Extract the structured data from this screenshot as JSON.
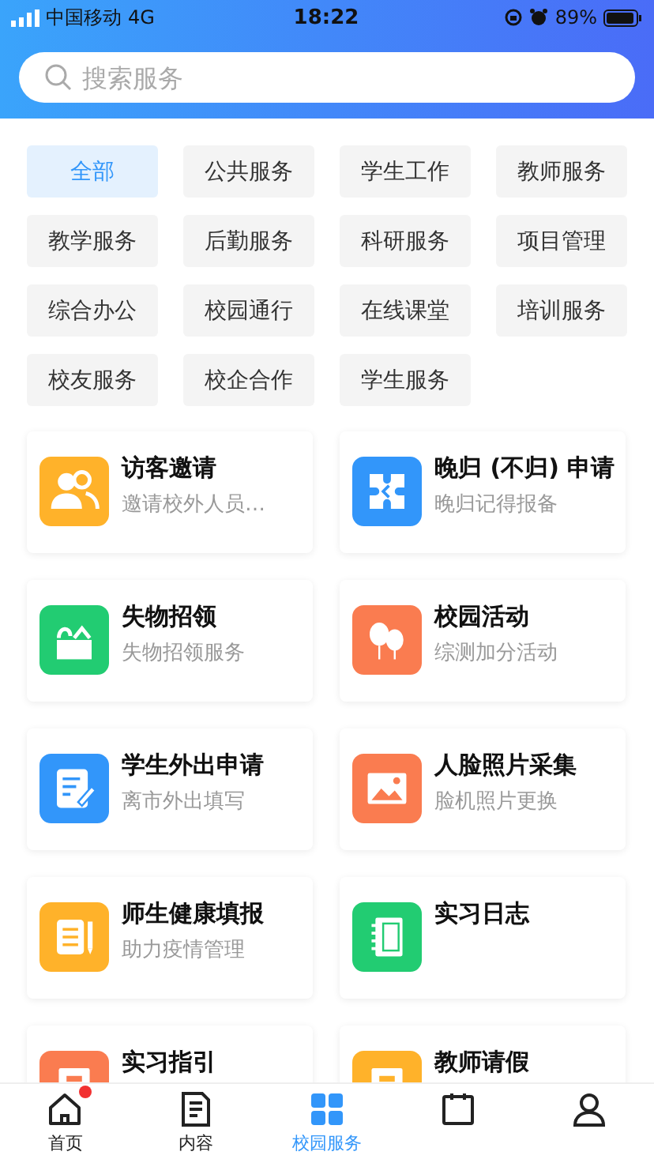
{
  "status_bar": {
    "carrier": "中国移动",
    "network": "4G",
    "time": "18:22",
    "battery": "89%"
  },
  "search": {
    "placeholder": "搜索服务"
  },
  "categories": [
    {
      "label": "全部",
      "selected": true
    },
    {
      "label": "公共服务",
      "selected": false
    },
    {
      "label": "学生工作",
      "selected": false
    },
    {
      "label": "教师服务",
      "selected": false
    },
    {
      "label": "教学服务",
      "selected": false
    },
    {
      "label": "后勤服务",
      "selected": false
    },
    {
      "label": "科研服务",
      "selected": false
    },
    {
      "label": "项目管理",
      "selected": false
    },
    {
      "label": "综合办公",
      "selected": false
    },
    {
      "label": "校园通行",
      "selected": false
    },
    {
      "label": "在线课堂",
      "selected": false
    },
    {
      "label": "培训服务",
      "selected": false
    },
    {
      "label": "校友服务",
      "selected": false
    },
    {
      "label": "校企合作",
      "selected": false
    },
    {
      "label": "学生服务",
      "selected": false
    }
  ],
  "services": [
    {
      "title": "访客邀请",
      "subtitle": "邀请校外人员…",
      "kind": "people",
      "color": "#ffb22a"
    },
    {
      "title": "晚归 (不归) 申请",
      "subtitle": "晚归记得报备",
      "kind": "puzzle",
      "color": "#3296fa"
    },
    {
      "title": "失物招领",
      "subtitle": "失物招领服务",
      "kind": "box",
      "color": "#22cc72"
    },
    {
      "title": "校园活动",
      "subtitle": "综测加分活动",
      "kind": "balloon",
      "color": "#fa7c50"
    },
    {
      "title": "学生外出申请",
      "subtitle": "离市外出填写",
      "kind": "form",
      "color": "#3296fa"
    },
    {
      "title": "人脸照片采集",
      "subtitle": "脸机照片更换",
      "kind": "image",
      "color": "#fa7c50"
    },
    {
      "title": "师生健康填报",
      "subtitle": "助力疫情管理",
      "kind": "note",
      "color": "#ffb22a"
    },
    {
      "title": "实习日志",
      "kind": "notebook",
      "color": "#22cc72"
    },
    {
      "title": "实习指引",
      "kind": "doc",
      "color": "#fa7c50"
    },
    {
      "title": "教师请假",
      "kind": "doc",
      "color": "#ffb22a"
    }
  ],
  "tab_bar": [
    {
      "label": "首页",
      "kind": "home",
      "selected": false,
      "badge": true
    },
    {
      "label": "内容",
      "kind": "content",
      "selected": false,
      "badge": false
    },
    {
      "label": "校园服务",
      "kind": "grid",
      "selected": true,
      "badge": false
    },
    {
      "kind": "calendar",
      "selected": false,
      "badge": false
    },
    {
      "kind": "person",
      "selected": false,
      "badge": false
    }
  ]
}
